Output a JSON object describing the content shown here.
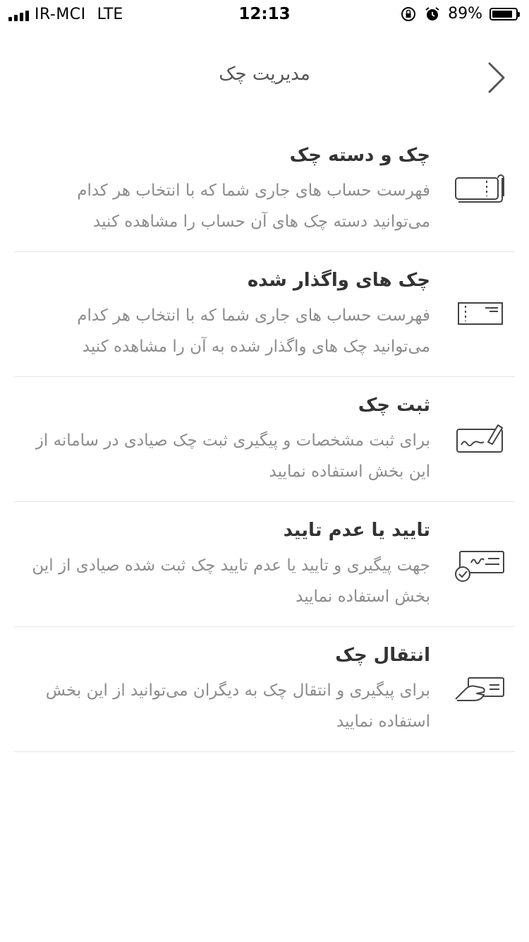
{
  "status_bar": {
    "carrier": "IR-MCI",
    "network": "LTE",
    "time": "12:13",
    "battery": "89%",
    "battery_level": 0.89
  },
  "nav": {
    "title": "مدیریت چک",
    "back_icon": "chevron-right-icon"
  },
  "menu": [
    {
      "title": "چک و دسته چک",
      "description": "فهرست حساب های جاری شما که با انتخاب هر کدام می‌توانید دسته چک های آن حساب را مشاهده کنید",
      "icon": "checkbook-icon"
    },
    {
      "title": "چک های واگذار شده",
      "description": "فهرست حساب های جاری شما که با انتخاب هر کدام می‌توانید چک های واگذار شده به آن را مشاهده کنید",
      "icon": "assigned-check-icon"
    },
    {
      "title": "ثبت چک",
      "description": "برای ثبت مشخصات و پیگیری ثبت چک صیادی در سامانه از این بخش استفاده نمایید",
      "icon": "check-sign-icon"
    },
    {
      "title": "تایید یا عدم تایید",
      "description": "جهت پیگیری و تایید یا عدم تایید چک ثبت شده صیادی از این بخش استفاده نمایید",
      "icon": "check-approve-icon"
    },
    {
      "title": "انتقال چک",
      "description": "برای پیگیری و انتقال چک به دیگران می‌توانید از این بخش استفاده نمایید",
      "icon": "check-transfer-icon"
    }
  ]
}
